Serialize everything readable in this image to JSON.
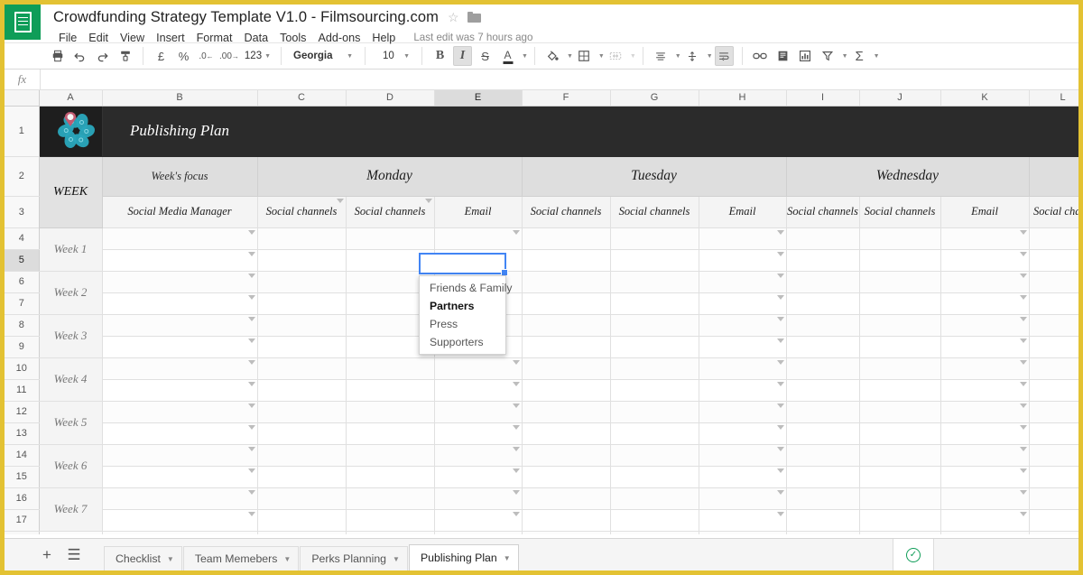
{
  "window": {
    "doc_title": "Crowdfunding Strategy Template V1.0 - Filmsourcing.com",
    "star_icon": "star-outline-icon",
    "folder_icon": "folder-icon",
    "app_logo": "google-sheets-icon"
  },
  "menubar": {
    "items": [
      "File",
      "Edit",
      "View",
      "Insert",
      "Format",
      "Data",
      "Tools",
      "Add-ons",
      "Help"
    ],
    "last_edit": "Last edit was 7 hours ago"
  },
  "toolbar": {
    "print": "print-icon",
    "undo": "undo-icon",
    "redo": "redo-icon",
    "paint_format": "paint-format-icon",
    "currency": "£",
    "percent": "%",
    "decrease_decimal": ".0",
    "increase_decimal": ".00",
    "number_format": "123",
    "font_name": "Georgia",
    "font_size": "10",
    "bold": "B",
    "italic": "I",
    "strikethrough": "S",
    "text_color": "A",
    "fill_color": "fill-color-icon",
    "borders": "borders-icon",
    "merge_cells": "merge-cells-icon",
    "horizontal_align": "horizontal-align-icon",
    "vertical_align": "vertical-align-icon",
    "text_wrap": "text-wrap-icon",
    "insert_link": "link-icon",
    "insert_comment": "comment-icon",
    "insert_chart": "chart-icon",
    "filter": "filter-icon",
    "functions": "Σ"
  },
  "formula_bar": {
    "fx_label": "fx",
    "value": ""
  },
  "grid": {
    "columns": [
      "A",
      "B",
      "C",
      "D",
      "E",
      "F",
      "G",
      "H",
      "I",
      "J",
      "K",
      "L"
    ],
    "selected_column": "E",
    "selected_row": "5",
    "rows": [
      "1",
      "2",
      "3",
      "4",
      "5",
      "6",
      "7",
      "8",
      "9",
      "10",
      "11",
      "12",
      "13",
      "14",
      "15",
      "16",
      "17"
    ],
    "banner_title": "Publishing Plan",
    "logo_icon": "flower-pin-logo-icon",
    "week_header": "WEEK",
    "weeks_focus_label": "Week's focus",
    "days": [
      "Monday",
      "Tuesday",
      "Wednesday"
    ],
    "subheaders": {
      "b": "Social Media Manager",
      "monday": [
        "Social channels",
        "Social channels",
        "Email"
      ],
      "tuesday": [
        "Social channels",
        "Social channels",
        "Email"
      ],
      "wednesday": [
        "Social channels",
        "Social channels",
        "Email"
      ],
      "thursday_partial": "Social chann"
    },
    "week_labels": [
      "Week 1",
      "Week 2",
      "Week 3",
      "Week 4",
      "Week 5",
      "Week 6",
      "Week 7"
    ]
  },
  "dropdown": {
    "visible": true,
    "options": [
      {
        "label": "Friends & Family",
        "selected": false
      },
      {
        "label": "Partners",
        "selected": true
      },
      {
        "label": "Press",
        "selected": false
      },
      {
        "label": "Supporters",
        "selected": false
      }
    ]
  },
  "sheetbar": {
    "add_sheet_icon": "plus-icon",
    "all_sheets_icon": "hamburger-list-icon",
    "tabs": [
      {
        "label": "Checklist",
        "active": false
      },
      {
        "label": "Team Memebers",
        "active": false
      },
      {
        "label": "Perks Planning",
        "active": false
      },
      {
        "label": "Publishing Plan",
        "active": true
      }
    ],
    "explore_icon": "check-circle-icon"
  },
  "colors": {
    "accent_green": "#0f9d58",
    "selection_blue": "#4285f4",
    "banner_dark": "#2b2b2b",
    "window_border": "#e3c233",
    "logo_teal": "#2aa7bd"
  }
}
